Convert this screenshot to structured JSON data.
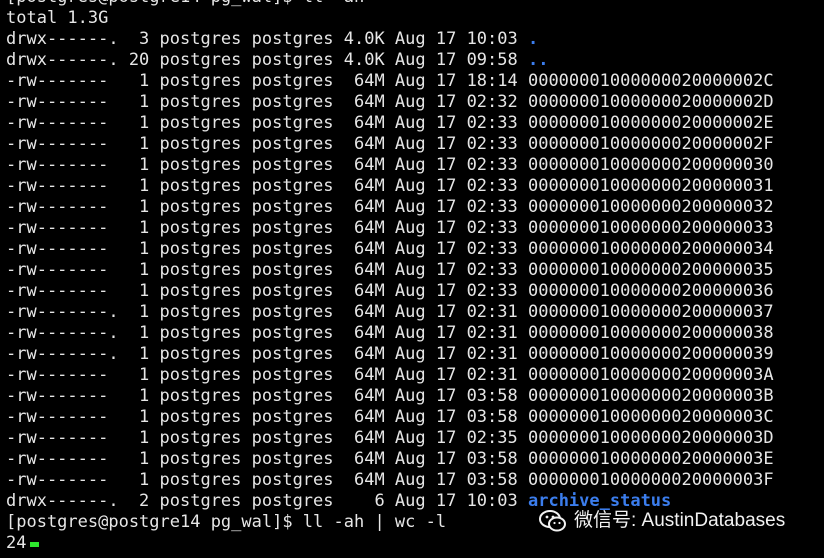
{
  "terminal": {
    "top_clipped_line": "[postgres@postgre14 pg_wal]$ ll -ah",
    "lines": [
      "total 1.3G",
      "drwx------.  3 postgres postgres 4.0K Aug 17 10:03 ",
      "drwx------. 20 postgres postgres 4.0K Aug 17 09:58 ",
      "-rw-------   1 postgres postgres  64M Aug 17 18:14 00000001000000020000002C",
      "-rw-------   1 postgres postgres  64M Aug 17 02:32 00000001000000020000002D",
      "-rw-------   1 postgres postgres  64M Aug 17 02:33 00000001000000020000002E",
      "-rw-------   1 postgres postgres  64M Aug 17 02:33 00000001000000020000002F",
      "-rw-------   1 postgres postgres  64M Aug 17 02:33 000000010000000200000030",
      "-rw-------   1 postgres postgres  64M Aug 17 02:33 000000010000000200000031",
      "-rw-------   1 postgres postgres  64M Aug 17 02:33 000000010000000200000032",
      "-rw-------   1 postgres postgres  64M Aug 17 02:33 000000010000000200000033",
      "-rw-------   1 postgres postgres  64M Aug 17 02:33 000000010000000200000034",
      "-rw-------   1 postgres postgres  64M Aug 17 02:33 000000010000000200000035",
      "-rw-------   1 postgres postgres  64M Aug 17 02:33 000000010000000200000036",
      "-rw-------.  1 postgres postgres  64M Aug 17 02:31 000000010000000200000037",
      "-rw-------.  1 postgres postgres  64M Aug 17 02:31 000000010000000200000038",
      "-rw-------.  1 postgres postgres  64M Aug 17 02:31 000000010000000200000039",
      "-rw-------   1 postgres postgres  64M Aug 17 02:31 00000001000000020000003A",
      "-rw-------   1 postgres postgres  64M Aug 17 03:58 00000001000000020000003B",
      "-rw-------   1 postgres postgres  64M Aug 17 03:58 00000001000000020000003C",
      "-rw-------   1 postgres postgres  64M Aug 17 02:35 00000001000000020000003D",
      "-rw-------   1 postgres postgres  64M Aug 17 03:58 00000001000000020000003E",
      "-rw-------   1 postgres postgres  64M Aug 17 03:58 00000001000000020000003F",
      "drwx------.  2 postgres postgres    6 Aug 17 10:03 ",
      "[postgres@postgre14 pg_wal]$ ll -ah | wc -l",
      "24"
    ],
    "dir_names": {
      "line_1": ".",
      "line_2": "..",
      "line_23": "archive_status"
    }
  },
  "watermark": {
    "text": "微信号: AustinDatabases",
    "icon": "wechat-icon"
  },
  "colors": {
    "background": "#000000",
    "text": "#e6e6e6",
    "directory": "#3b7ded",
    "cursor": "#2ee82e"
  }
}
